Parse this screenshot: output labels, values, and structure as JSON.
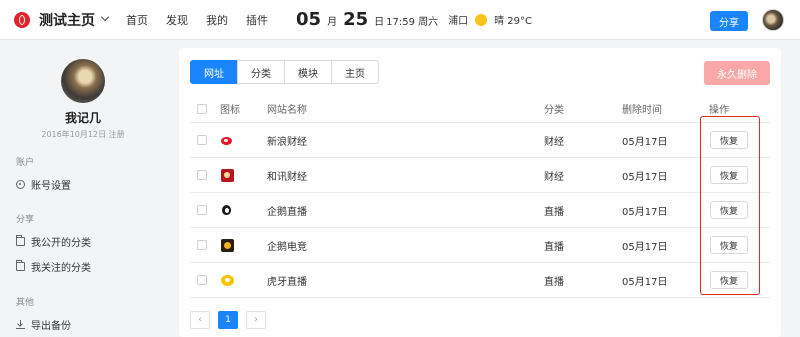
{
  "header": {
    "title": "测试主页",
    "nav": [
      "首页",
      "发现",
      "我的",
      "插件"
    ],
    "month": "05",
    "month_unit": "月",
    "day": "25",
    "day_unit": "日",
    "time_weekday": "17:59 周六",
    "city": "浦口",
    "weather": "晴 29°C",
    "share_label": "分享"
  },
  "sidebar": {
    "user_name": "我记几",
    "register_date": "2016年10月12日 注册",
    "section_account": "账户",
    "account_settings": "账号设置",
    "section_share": "分享",
    "my_public_categories": "我公开的分类",
    "my_followed_categories": "我关注的分类",
    "section_other": "其他",
    "export_backup": "导出备份"
  },
  "tabs": [
    {
      "label": "网址",
      "active": true
    },
    {
      "label": "分类",
      "active": false
    },
    {
      "label": "模块",
      "active": false
    },
    {
      "label": "主页",
      "active": false
    }
  ],
  "delete_forever_label": "永久删除",
  "table": {
    "columns": [
      "图标",
      "网站名称",
      "分类",
      "删除时间",
      "操作"
    ],
    "rows": [
      {
        "icon": "sina-weibo-icon",
        "name": "新浪财经",
        "category": "财经",
        "deleted": "05月17日",
        "action": "恢复"
      },
      {
        "icon": "hexun-icon",
        "name": "和讯财经",
        "category": "财经",
        "deleted": "05月17日",
        "action": "恢复"
      },
      {
        "icon": "qq-penguin-icon",
        "name": "企鹅直播",
        "category": "直播",
        "deleted": "05月17日",
        "action": "恢复"
      },
      {
        "icon": "qq-esports-icon",
        "name": "企鹅电竞",
        "category": "直播",
        "deleted": "05月17日",
        "action": "恢复"
      },
      {
        "icon": "huya-icon",
        "name": "虎牙直播",
        "category": "直播",
        "deleted": "05月17日",
        "action": "恢复"
      }
    ]
  },
  "pagination": {
    "prev": "‹",
    "current": "1",
    "next": "›"
  },
  "colors": {
    "accent": "#1a85ff",
    "danger_light": "#f9a7a7",
    "highlight": "#e02b1f"
  }
}
